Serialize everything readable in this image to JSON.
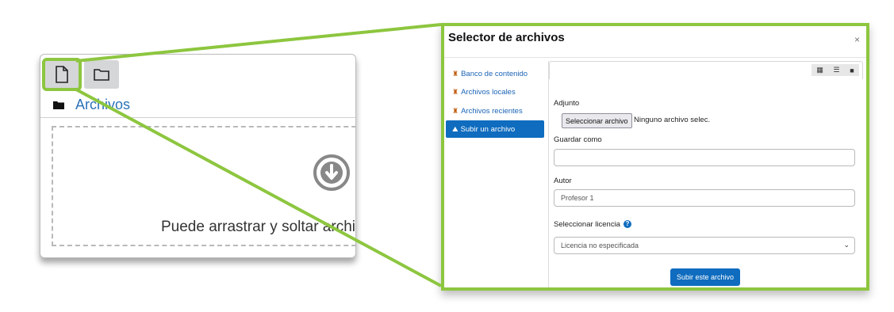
{
  "left": {
    "path_label": "Archivos",
    "drop_text": "Puede arrastrar y soltar archiv"
  },
  "dialog": {
    "title": "Selector de archivos",
    "close": "×",
    "repositories": [
      {
        "label": "Banco de contenido",
        "icon": "repository-icon"
      },
      {
        "label": "Archivos locales",
        "icon": "repository-icon"
      },
      {
        "label": "Archivos recientes",
        "icon": "repository-icon"
      },
      {
        "label": "Subir un archivo",
        "icon": "upload-icon",
        "active": true
      }
    ],
    "view_icons": [
      "grid-view-icon",
      "list-view-icon",
      "folder-view-icon"
    ],
    "form": {
      "attachment_label": "Adjunto",
      "choose_file_button": "Seleccionar archivo",
      "no_file_text": "Ninguno archivo selec.",
      "save_as_label": "Guardar como",
      "save_as_value": "",
      "author_label": "Autor",
      "author_value": "Profesor 1",
      "license_label": "Seleccionar licencia",
      "license_value": "Licencia no especificada",
      "submit_button": "Subir este archivo"
    }
  },
  "colors": {
    "highlight": "#8dc63f",
    "primary": "#0f6cbf",
    "link": "#2d72b8"
  }
}
